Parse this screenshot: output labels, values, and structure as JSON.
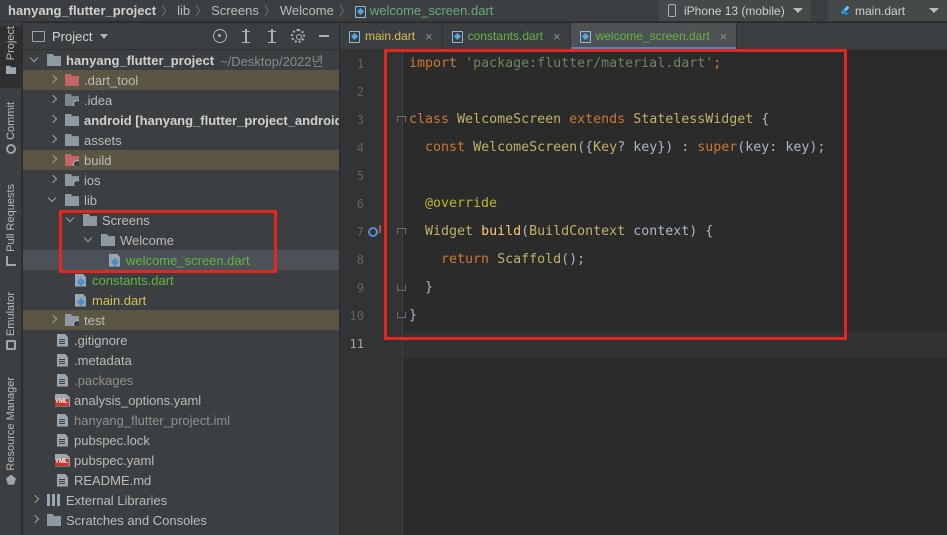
{
  "breadcrumb": {
    "project": "hanyang_flutter_project",
    "items": [
      "lib",
      "Screens",
      "Welcome"
    ],
    "file": "welcome_screen.dart"
  },
  "toolbar": {
    "device": "iPhone 13 (mobile)",
    "run_config": "main.dart"
  },
  "toolwindow_tabs": [
    "Project",
    "Commit",
    "Pull Requests",
    "Emulator",
    "Resource Manager"
  ],
  "project_panel": {
    "title": "Project",
    "tree": [
      {
        "label": "hanyang_flutter_project",
        "path": "~/Desktop/2022년"
      },
      {
        "label": ".dart_tool"
      },
      {
        "label": ".idea"
      },
      {
        "label": "android [hanyang_flutter_project_android]"
      },
      {
        "label": "assets"
      },
      {
        "label": "build"
      },
      {
        "label": "ios"
      },
      {
        "label": "lib"
      },
      {
        "label": "Screens"
      },
      {
        "label": "Welcome"
      },
      {
        "label": "welcome_screen.dart"
      },
      {
        "label": "constants.dart"
      },
      {
        "label": "main.dart"
      },
      {
        "label": "test"
      },
      {
        "label": ".gitignore"
      },
      {
        "label": ".metadata"
      },
      {
        "label": ".packages"
      },
      {
        "label": "analysis_options.yaml"
      },
      {
        "label": "hanyang_flutter_project.iml"
      },
      {
        "label": "pubspec.lock"
      },
      {
        "label": "pubspec.yaml"
      },
      {
        "label": "README.md"
      },
      {
        "label": "External Libraries"
      },
      {
        "label": "Scratches and Consoles"
      }
    ]
  },
  "editor_tabs": [
    {
      "label": "main.dart",
      "close": "×"
    },
    {
      "label": "constants.dart",
      "close": "×"
    },
    {
      "label": "welcome_screen.dart",
      "close": "×"
    }
  ],
  "line_numbers": [
    "1",
    "2",
    "3",
    "4",
    "5",
    "6",
    "7",
    "8",
    "9",
    "10",
    "11"
  ],
  "code": {
    "l1": {
      "kw": "import",
      "str": "'package:flutter/material.dart'",
      "end": ";"
    },
    "l3": {
      "kw1": "class",
      "name": "WelcomeScreen",
      "kw2": "extends",
      "base": "StatelessWidget",
      "end": " {"
    },
    "l4": {
      "kw": "const",
      "name": "WelcomeScreen",
      "p1": "({",
      "ty": "Key",
      "p2": "? key}) : ",
      "kw2": "super",
      "p3": "(key: key);"
    },
    "l6": {
      "ann": "@override"
    },
    "l7": {
      "ty1": "Widget",
      "fn": "build",
      "p1": "(",
      "ty2": "BuildContext",
      "p2": " context) {"
    },
    "l8": {
      "kw": "return",
      "ty": "Scaffold",
      "p": "();"
    },
    "l9": "}",
    "l10": "}"
  }
}
